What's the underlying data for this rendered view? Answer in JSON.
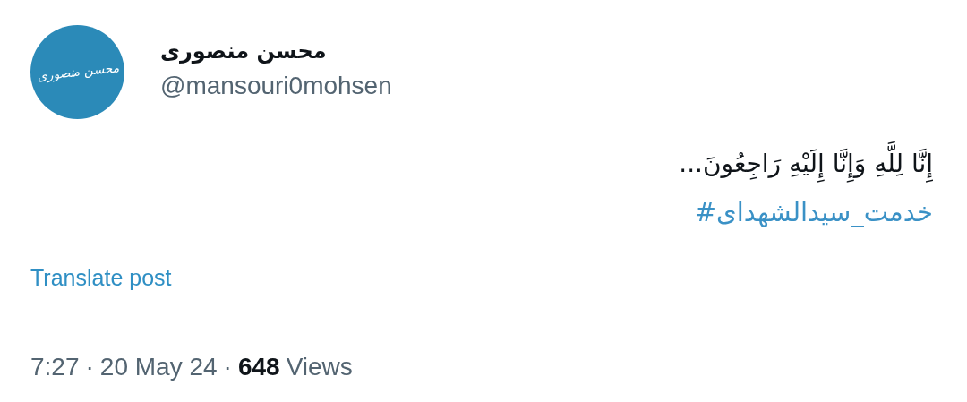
{
  "author": {
    "avatar_text": "محسن منصوری",
    "name": "محسن منصوری",
    "handle": "@mansouri0mohsen"
  },
  "post": {
    "text": "إِنَّا لِلَّهِ وَإِنَّا إِلَيْهِ رَاجِعُونَ...",
    "hashtag": "#خدمت_سیدالشهدای"
  },
  "translate_link": "Translate post",
  "meta": {
    "time": "7:27",
    "separator_1": "·",
    "date": "20 May 24",
    "separator_2": "·",
    "views_count": "648",
    "views_label": "Views"
  }
}
